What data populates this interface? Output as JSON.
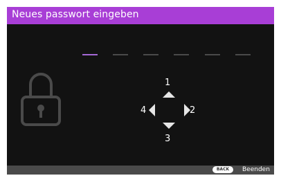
{
  "dialog": {
    "title": "Neues passwort eingeben"
  },
  "password": {
    "length": 6,
    "active_index": 0
  },
  "keypad": {
    "up": "1",
    "right": "2",
    "down": "3",
    "left": "4"
  },
  "status_bar": {
    "back_key": "BACK",
    "exit_label": "Beenden"
  },
  "colors": {
    "title_bar": "#a83ed6",
    "background": "#121212",
    "active_dash": "#a569d6",
    "inactive_dash": "#4a4a4a",
    "status_bar": "#4a4a4a"
  }
}
